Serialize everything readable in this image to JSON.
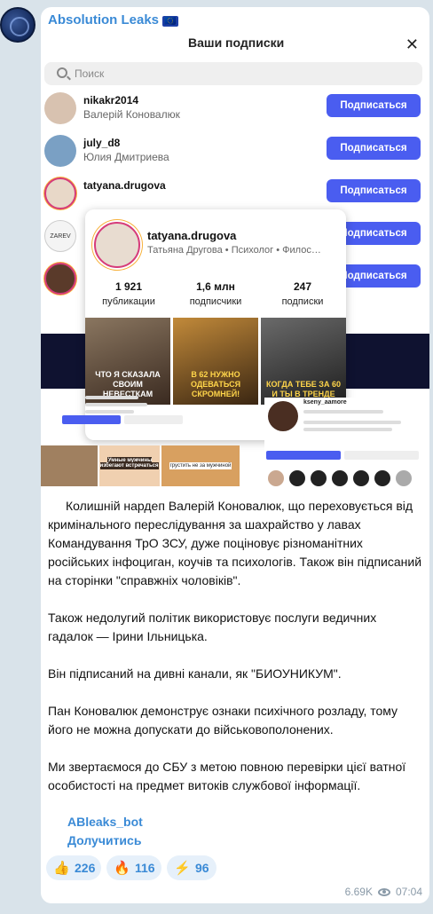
{
  "channel": {
    "title": "Absolution Leaks",
    "flag": "🇪🇺"
  },
  "subscriptions_panel": {
    "title": "Ваши подписки",
    "close": "✕",
    "search_placeholder": "Поиск",
    "subscribe_label": "Подписаться",
    "rows": [
      {
        "handle": "nikakr2014",
        "name": "Валерій Коновалюк"
      },
      {
        "handle": "july_d8",
        "name": "Юлия Дмитриева"
      },
      {
        "handle": "tatyana.drugova",
        "name": ""
      },
      {
        "handle": "",
        "name": ""
      },
      {
        "handle": "",
        "name": ""
      },
      {
        "handle": "",
        "name": ""
      }
    ],
    "zarev_label": "ZAREV"
  },
  "profile_card": {
    "handle": "tatyana.drugova",
    "description": "Татьяна Другова • Психолог • Филос…",
    "stats": [
      {
        "value": "1 921",
        "label": "публикации"
      },
      {
        "value": "1,6 млн",
        "label": "подписчики"
      },
      {
        "value": "247",
        "label": "подписки"
      }
    ],
    "images": [
      {
        "caption": "ЧТО Я СКАЗАЛА СВОИМ НЕВЕСТКАМ"
      },
      {
        "caption": "В 62 НУЖНО ОДЕВАТЬСЯ СКРОМНЕЙ!"
      },
      {
        "caption": "КОГДА ТЕБЕ ЗА 60 И ТЫ В ТРЕНДЕ"
      }
    ]
  },
  "mini_profile": {
    "handle": "kseny_aamore"
  },
  "left_mini": {
    "img_caption_1": "Умные мужчины избегают встречаться",
    "img_caption_2": "грустить не за мужчиной"
  },
  "post": {
    "paragraphs": [
      "Колишній нардеп Валерій Коновалюк, що переховується від кримінального переслідування за шахрайство у лавах Командування ТрО ЗСУ, дуже поціновує різноманітних російських інфоциган, коучів та психологів. Також він підписаний на сторінки \"справжніх чоловіків\".",
      "Також недолугий політик використовує послуги ведичних гадалок — Ірини Ільницька.",
      "Він підписаний на дивні канали, як \"БИОУНИКУМ\".",
      "Пан Коновалюк демонструє ознаки психічного розладу, тому його не можна допускати до військовополонених.",
      "Ми звертаємося до СБУ з метою повною перевірки цієї ватної особистості на предмет витоків службової інформації."
    ],
    "link_bot": "ABleaks_bot",
    "link_join": "Долучитись"
  },
  "reactions": [
    {
      "emoji": "👍",
      "count": "226"
    },
    {
      "emoji": "🔥",
      "count": "116"
    },
    {
      "emoji": "⚡",
      "count": "96"
    }
  ],
  "meta": {
    "views": "6.69K",
    "time": "07:04"
  }
}
